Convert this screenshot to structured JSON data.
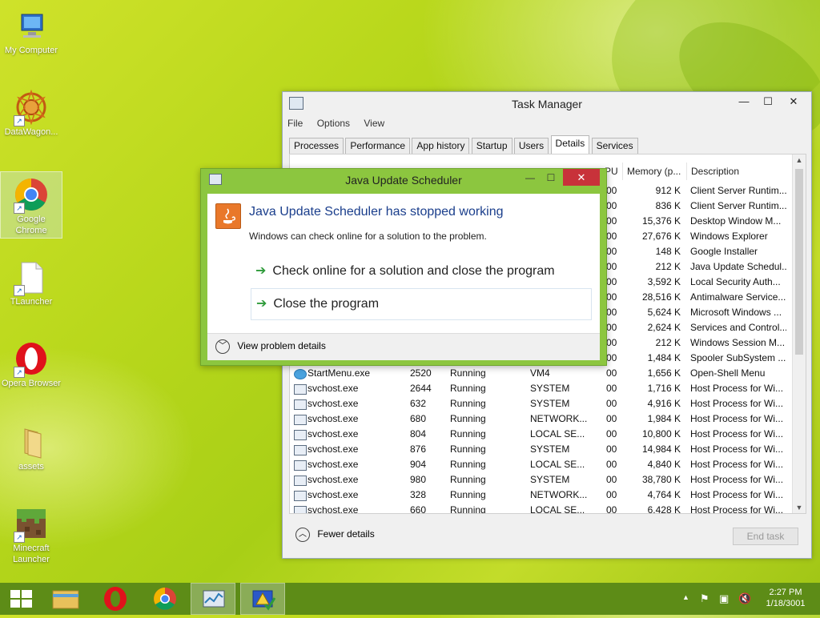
{
  "desktop_icons": [
    {
      "label": "My Computer",
      "icon": "computer-icon"
    },
    {
      "label": "DataWagon...",
      "icon": "mandala-icon"
    },
    {
      "label": "Google Chrome",
      "icon": "chrome-icon"
    },
    {
      "label": "TLauncher",
      "icon": "file-icon"
    },
    {
      "label": "Opera Browser",
      "icon": "opera-icon"
    },
    {
      "label": "assets",
      "icon": "folder-icon"
    },
    {
      "label": "Minecraft Launcher",
      "icon": "minecraft-icon"
    }
  ],
  "task_manager": {
    "title": "Task Manager",
    "menu": [
      "File",
      "Options",
      "View"
    ],
    "tabs": [
      "Processes",
      "Performance",
      "App history",
      "Startup",
      "Users",
      "Details",
      "Services"
    ],
    "active_tab": "Details",
    "columns": {
      "cpu": "PU",
      "memory": "Memory (p...",
      "description": "Description"
    },
    "rows": [
      {
        "name": "",
        "pid": "",
        "status": "",
        "user": "",
        "cpu": "00",
        "memory": "912 K",
        "description": "Client Server Runtim..."
      },
      {
        "name": "",
        "pid": "",
        "status": "",
        "user": "",
        "cpu": "00",
        "memory": "836 K",
        "description": "Client Server Runtim..."
      },
      {
        "name": "",
        "pid": "",
        "status": "",
        "user": "",
        "cpu": "00",
        "memory": "15,376 K",
        "description": "Desktop Window M..."
      },
      {
        "name": "",
        "pid": "",
        "status": "",
        "user": "",
        "cpu": "00",
        "memory": "27,676 K",
        "description": "Windows Explorer"
      },
      {
        "name": "",
        "pid": "",
        "status": "",
        "user": "",
        "cpu": "00",
        "memory": "148 K",
        "description": "Google Installer"
      },
      {
        "name": "",
        "pid": "",
        "status": "",
        "user": "",
        "cpu": "00",
        "memory": "212 K",
        "description": "Java Update Schedul..."
      },
      {
        "name": "",
        "pid": "",
        "status": "",
        "user": "",
        "cpu": "00",
        "memory": "3,592 K",
        "description": "Local Security Auth..."
      },
      {
        "name": "",
        "pid": "",
        "status": "",
        "user": "",
        "cpu": "00",
        "memory": "28,516 K",
        "description": "Antimalware Service..."
      },
      {
        "name": "",
        "pid": "",
        "status": "",
        "user": "",
        "cpu": "00",
        "memory": "5,624 K",
        "description": "Microsoft Windows ..."
      },
      {
        "name": "",
        "pid": "",
        "status": "",
        "user": "",
        "cpu": "00",
        "memory": "2,624 K",
        "description": "Services and Control..."
      },
      {
        "name": "",
        "pid": "",
        "status": "",
        "user": "",
        "cpu": "00",
        "memory": "212 K",
        "description": "Windows Session M..."
      },
      {
        "name": "",
        "pid": "",
        "status": "",
        "user": "",
        "cpu": "00",
        "memory": "1,484 K",
        "description": "Spooler SubSystem ..."
      },
      {
        "name": "StartMenu.exe",
        "pid": "2520",
        "status": "Running",
        "user": "VM4",
        "cpu": "00",
        "memory": "1,656 K",
        "description": "Open-Shell Menu",
        "icon": "globe"
      },
      {
        "name": "svchost.exe",
        "pid": "2644",
        "status": "Running",
        "user": "SYSTEM",
        "cpu": "00",
        "memory": "1,716 K",
        "description": "Host Process for Wi..."
      },
      {
        "name": "svchost.exe",
        "pid": "632",
        "status": "Running",
        "user": "SYSTEM",
        "cpu": "00",
        "memory": "4,916 K",
        "description": "Host Process for Wi..."
      },
      {
        "name": "svchost.exe",
        "pid": "680",
        "status": "Running",
        "user": "NETWORK...",
        "cpu": "00",
        "memory": "1,984 K",
        "description": "Host Process for Wi..."
      },
      {
        "name": "svchost.exe",
        "pid": "804",
        "status": "Running",
        "user": "LOCAL SE...",
        "cpu": "00",
        "memory": "10,800 K",
        "description": "Host Process for Wi..."
      },
      {
        "name": "svchost.exe",
        "pid": "876",
        "status": "Running",
        "user": "SYSTEM",
        "cpu": "00",
        "memory": "14,984 K",
        "description": "Host Process for Wi..."
      },
      {
        "name": "svchost.exe",
        "pid": "904",
        "status": "Running",
        "user": "LOCAL SE...",
        "cpu": "00",
        "memory": "4,840 K",
        "description": "Host Process for Wi..."
      },
      {
        "name": "svchost.exe",
        "pid": "980",
        "status": "Running",
        "user": "SYSTEM",
        "cpu": "00",
        "memory": "38,780 K",
        "description": "Host Process for Wi..."
      },
      {
        "name": "svchost.exe",
        "pid": "328",
        "status": "Running",
        "user": "NETWORK...",
        "cpu": "00",
        "memory": "4,764 K",
        "description": "Host Process for Wi..."
      },
      {
        "name": "svchost.exe",
        "pid": "660",
        "status": "Running",
        "user": "LOCAL SE...",
        "cpu": "00",
        "memory": "6,428 K",
        "description": "Host Process for Wi..."
      }
    ],
    "fewer_details": "Fewer details",
    "end_task": "End task"
  },
  "dialog": {
    "title": "Java Update Scheduler",
    "heading": "Java Update Scheduler has stopped working",
    "subtext": "Windows can check online for a solution to the problem.",
    "option_check": "Check online for a solution and close the program",
    "option_close": "Close the program",
    "view_details": "View problem details"
  },
  "taskbar": {
    "apps": [
      "start-icon",
      "file-explorer-icon",
      "opera-icon",
      "chrome-icon",
      "task-manager-icon",
      "java-error-icon"
    ],
    "time": "2:27 PM",
    "date": "1/18/3001"
  },
  "colors": {
    "accent": "#8cc63f",
    "taskbar": "#5d8c17",
    "close": "#c8323a",
    "heading": "#1a3e8c"
  }
}
